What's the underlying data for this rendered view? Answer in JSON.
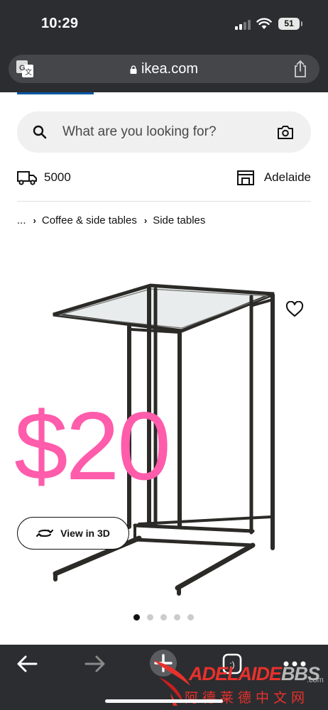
{
  "status_bar": {
    "time": "10:29",
    "battery": "51"
  },
  "browser": {
    "url": "ikea.com"
  },
  "search": {
    "placeholder": "What are you looking for?"
  },
  "delivery": {
    "postcode": "5000",
    "store": "Adelaide"
  },
  "breadcrumb": {
    "ellipsis": "...",
    "items": [
      "Coffee & side tables",
      "Side tables"
    ]
  },
  "product": {
    "price_overlay": "$20",
    "view_3d_label": "View in 3D",
    "image_count": 5,
    "active_image": 0
  },
  "watermark": {
    "brand_left": "ADELAIDE",
    "brand_right": "BBS",
    "domain_suffix": ".com",
    "tagline": "阿德莱德中文网"
  },
  "colors": {
    "ikea_blue": "#0058a3",
    "price_pink": "#ff5cab",
    "chrome_dark": "#2b2d30"
  },
  "icons": [
    "translate-icon",
    "lock-icon",
    "share-icon",
    "search-icon",
    "camera-icon",
    "truck-icon",
    "store-icon",
    "heart-icon",
    "rotate-3d-icon",
    "back-arrow-icon",
    "forward-arrow-icon",
    "new-tab-icon",
    "tabs-icon",
    "more-icon"
  ]
}
